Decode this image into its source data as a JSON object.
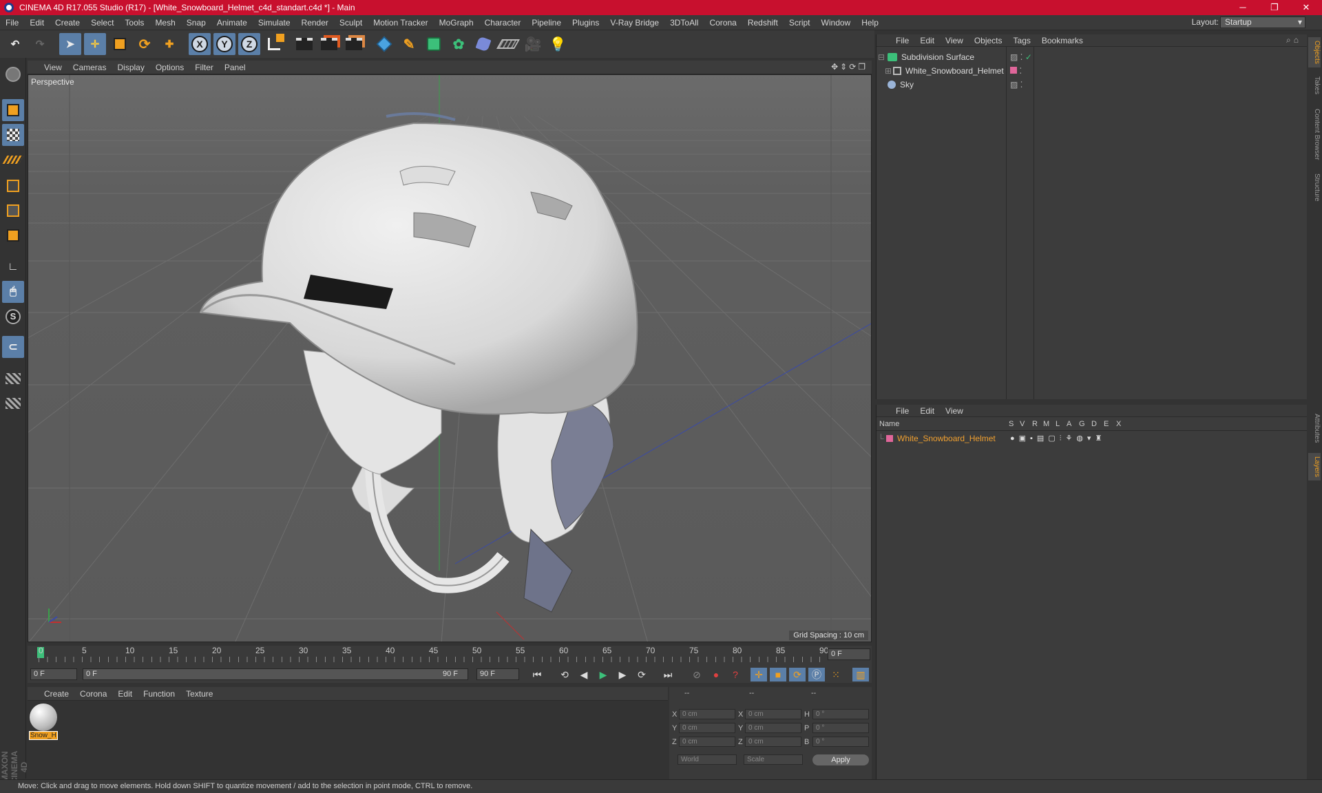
{
  "window": {
    "title": "CINEMA 4D R17.055 Studio (R17) - [White_Snowboard_Helmet_c4d_standart.c4d *] - Main",
    "controls": [
      "─",
      "❐",
      "✕"
    ]
  },
  "menubar": {
    "items": [
      "File",
      "Edit",
      "Create",
      "Select",
      "Tools",
      "Mesh",
      "Snap",
      "Animate",
      "Simulate",
      "Render",
      "Sculpt",
      "Motion Tracker",
      "MoGraph",
      "Character",
      "Pipeline",
      "Plugins",
      "V-Ray Bridge",
      "3DToAll",
      "Corona",
      "Redshift",
      "Script",
      "Window",
      "Help"
    ],
    "layout_label": "Layout:",
    "layout_value": "Startup"
  },
  "toolbar": {
    "axis_x": "X",
    "axis_y": "Y",
    "axis_z": "Z"
  },
  "viewport": {
    "menu": [
      "View",
      "Cameras",
      "Display",
      "Options",
      "Filter",
      "Panel"
    ],
    "label": "Perspective",
    "grid_spacing": "Grid Spacing : 10 cm"
  },
  "timeline": {
    "ticks": [
      "0",
      "5",
      "10",
      "15",
      "20",
      "25",
      "30",
      "35",
      "40",
      "45",
      "50",
      "55",
      "60",
      "65",
      "70",
      "75",
      "80",
      "85",
      "90"
    ],
    "current_frame_right": "0 F",
    "start_field": "0 F",
    "range_start": "0 F",
    "range_end": "90 F",
    "end_field": "90 F"
  },
  "material_manager": {
    "menu": [
      "Create",
      "Corona",
      "Edit",
      "Function",
      "Texture"
    ],
    "material_name": "Snow_H"
  },
  "coordinates": {
    "headers": [
      "--",
      "--",
      "--"
    ],
    "rows": [
      {
        "l1": "X",
        "v1": "0 cm",
        "l2": "X",
        "v2": "0 cm",
        "l3": "H",
        "v3": "0 °"
      },
      {
        "l1": "Y",
        "v1": "0 cm",
        "l2": "Y",
        "v2": "0 cm",
        "l3": "P",
        "v3": "0 °"
      },
      {
        "l1": "Z",
        "v1": "0 cm",
        "l2": "Z",
        "v2": "0 cm",
        "l3": "B",
        "v3": "0 °"
      }
    ],
    "mode1": "World",
    "mode2": "Scale",
    "apply": "Apply"
  },
  "object_manager": {
    "menu": [
      "File",
      "Edit",
      "View",
      "Objects",
      "Tags",
      "Bookmarks"
    ],
    "objects": [
      {
        "name": "Subdivision Surface",
        "icon": "subdivision-icon"
      },
      {
        "name": "White_Snowboard_Helmet",
        "icon": "null-object-icon"
      },
      {
        "name": "Sky",
        "icon": "sky-icon"
      }
    ]
  },
  "layer_manager": {
    "menu": [
      "File",
      "Edit",
      "View"
    ],
    "columns": [
      "Name",
      "S",
      "V",
      "R",
      "M",
      "L",
      "A",
      "G",
      "D",
      "E",
      "X"
    ],
    "layers": [
      {
        "name": "White_Snowboard_Helmet",
        "color": "#e0669a"
      }
    ]
  },
  "side_tabs": [
    "Objects",
    "Takes",
    "Content Browser",
    "Structure",
    "Attributes",
    "Layers"
  ],
  "status": "Move: Click and drag to move elements. Hold down SHIFT to quantize movement / add to the selection in point mode, CTRL to remove.",
  "brand": "MAXON CINEMA 4D",
  "colors": {
    "title_bar": "#c8102e",
    "accent": "#5b7fa8",
    "layer_name": "#f0a030"
  }
}
